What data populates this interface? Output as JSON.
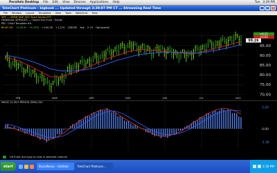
{
  "mac_menu": {
    "apple": "",
    "app": "Parallels Desktop",
    "items": [
      "File",
      "Edit",
      "View",
      "Devices",
      "Applications",
      "Help"
    ],
    "right_items": [
      "Tue",
      "3:39 PM"
    ]
  },
  "window": {
    "title": "TeleChart Platinum - bigbook ... Updated through 3:39:07 PM CT ... Streaming Real Time",
    "min": "_",
    "max": "□",
    "close": "×"
  },
  "menu": [
    "File",
    "Window",
    "Layout",
    "Templates",
    "View",
    "Tools",
    "WatchList",
    "Help"
  ],
  "header": {
    "line1": "SPY — SPDR S&P 500 Trust Series ETF",
    "line2": "FINANCIAL SERVICES — Closed End Fund - Equity",
    "line3": "PBI - Chart Template #4",
    "line4": [
      "89.87 VH",
      "+1.55 H",
      "+1.27%",
      "+100.28",
      "+1,274",
      "22855E",
      "Ask",
      "2.19",
      "Optionable"
    ]
  },
  "price_axis": {
    "ticks": [
      "100.00",
      "95.00",
      "90.00",
      "85.00",
      "80.00",
      "75.00",
      "70.00"
    ],
    "badge_top": "+6.21",
    "badge_mid": "+6.81",
    "current": "99.26"
  },
  "months": [
    "FEB",
    "MAR",
    "APR",
    "MAY",
    "JUN",
    "JUL",
    "AUG"
  ],
  "macd": {
    "label": "MACD 12,26,9 PERIOD (SMA) DLY",
    "top_value": "2.20",
    "zero": "0.00",
    "bottom_value": "-1.36"
  },
  "status": {
    "text": "Hit Enter and type to chat in selected channel"
  },
  "taskbar": {
    "start": "start",
    "tasks": [
      "StockWorkz - Untitled",
      "TeleChart Platinum..."
    ],
    "clock": "4:39 PM"
  },
  "chart_data": {
    "type": "line",
    "title": "",
    "xlabel": "",
    "ylabel": "",
    "categories": [
      "FEB",
      "MAR",
      "APR",
      "MAY",
      "JUN",
      "JUL",
      "AUG"
    ],
    "ylim": [
      68,
      102
    ],
    "series": [
      {
        "values": [
          88.0,
          85.0,
          82.0,
          79.0,
          75.0,
          78.0,
          84.0,
          86.0,
          88.0,
          91.0,
          93.0,
          95.0,
          94.0,
          92.0,
          93.0,
          91.0,
          90.0,
          92.0,
          95.0,
          96.0,
          98.0,
          99.0
        ]
      },
      {
        "values": [
          89.0,
          87.5,
          85.0,
          82.0,
          79.0,
          79.0,
          81.0,
          83.0,
          85.5,
          88.0,
          90.0,
          92.0,
          93.0,
          92.5,
          92.0,
          91.5,
          91.0,
          91.0,
          92.5,
          94.0,
          95.5,
          97.0
        ]
      },
      {
        "values": [
          90.0,
          89.0,
          87.5,
          85.5,
          83.0,
          82.0,
          82.0,
          82.5,
          83.5,
          85.5,
          87.5,
          89.0,
          90.5,
          91.0,
          91.5,
          91.5,
          91.3,
          91.2,
          91.8,
          92.8,
          94.0,
          95.5
        ]
      }
    ],
    "macd_bars": [
      0.4,
      0.1,
      -0.3,
      -0.6,
      -1.0,
      -1.3,
      -0.8,
      -0.2,
      0.4,
      0.9,
      1.4,
      1.8,
      2.0,
      1.6,
      1.0,
      0.5,
      0.1,
      -0.4,
      -0.8,
      -0.9,
      -0.6,
      -0.1,
      0.5,
      1.0,
      1.5,
      1.8,
      2.0,
      1.7,
      1.2
    ],
    "macd_line": [
      0.2,
      0.0,
      -0.3,
      -0.6,
      -0.9,
      -1.2,
      -0.9,
      -0.4,
      0.3,
      0.9,
      1.4,
      1.8,
      2.0,
      1.7,
      1.1,
      0.6,
      0.1,
      -0.3,
      -0.7,
      -0.8,
      -0.6,
      -0.2,
      0.4,
      1.0,
      1.5,
      1.9,
      2.1,
      1.9,
      1.5
    ],
    "signal_line": [
      0.5,
      0.3,
      0.0,
      -0.3,
      -0.6,
      -0.9,
      -0.9,
      -0.7,
      -0.2,
      0.3,
      0.9,
      1.4,
      1.7,
      1.8,
      1.5,
      1.0,
      0.5,
      0.0,
      -0.4,
      -0.6,
      -0.6,
      -0.4,
      0.0,
      0.5,
      1.0,
      1.5,
      1.8,
      1.9,
      1.8
    ],
    "colors": {
      "bars_up": "#7ddc1f",
      "bars_down": "#2ca02c",
      "red": "#e0201e",
      "blue": "#2f63ff",
      "black": "#1a1a1a",
      "macd_hist": "#5a8cff",
      "macd_line": "#e23b2e"
    }
  }
}
